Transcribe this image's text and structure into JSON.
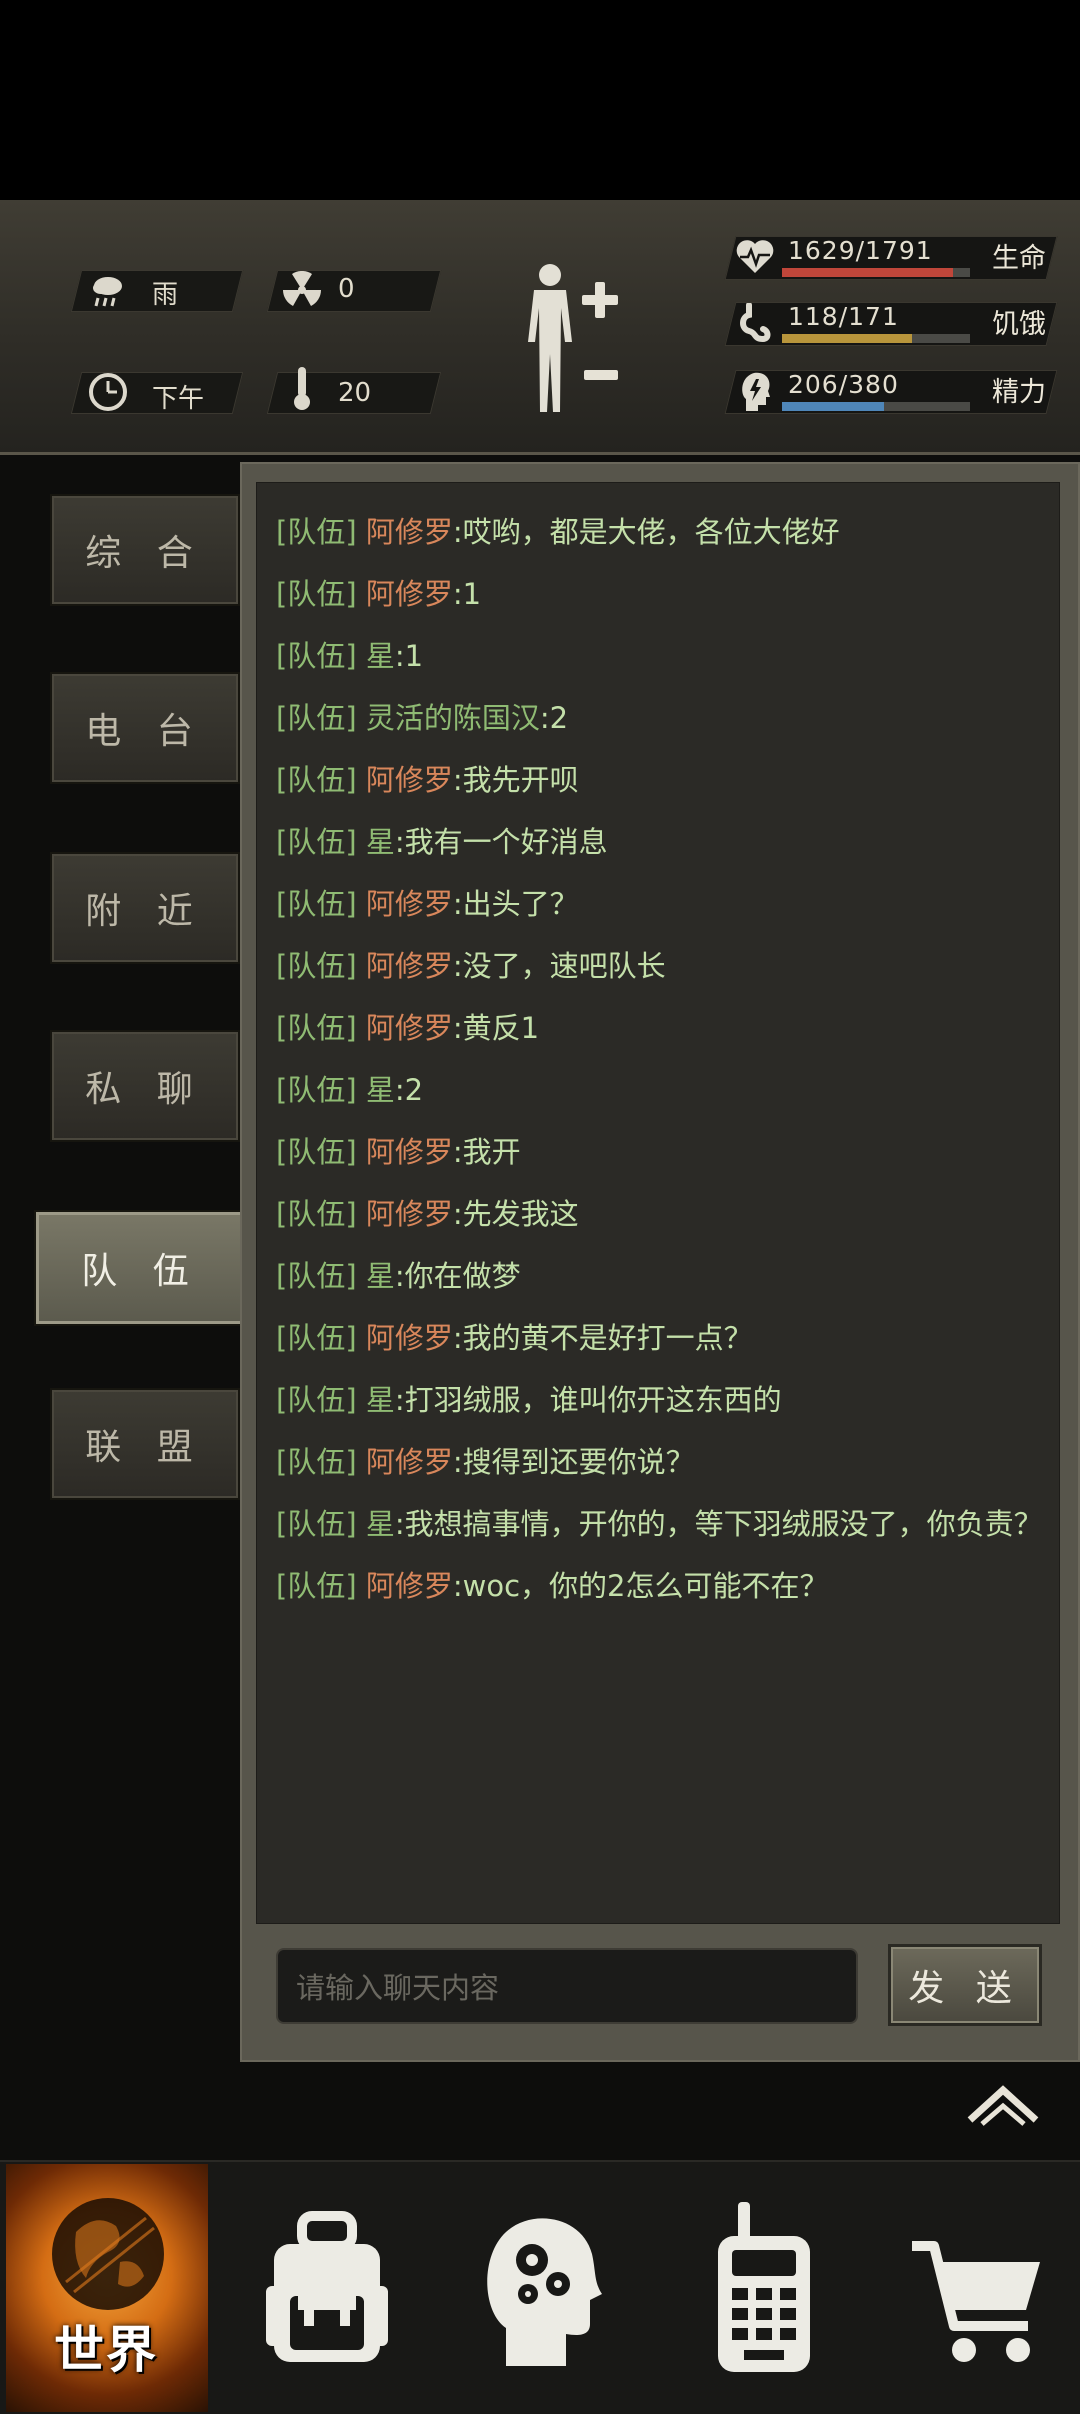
{
  "hud": {
    "weather": "雨",
    "radiation": "0",
    "time_of_day": "下午",
    "temperature": "20",
    "stats": [
      {
        "icon": "heart-pulse-icon",
        "value": "1629/1791",
        "label": "生命",
        "fill_fraction": 0.91,
        "color": "#c0463a"
      },
      {
        "icon": "stomach-icon",
        "value": "118/171",
        "label": "饥饿",
        "fill_fraction": 0.69,
        "color": "#b8953b"
      },
      {
        "icon": "energy-head-icon",
        "value": "206/380",
        "label": "精力",
        "fill_fraction": 0.54,
        "color": "#4f86b8"
      }
    ]
  },
  "tabs": [
    {
      "label": "综 合",
      "active": false
    },
    {
      "label": "电 台",
      "active": false
    },
    {
      "label": "附 近",
      "active": false
    },
    {
      "label": "私 聊",
      "active": false
    },
    {
      "label": "队 伍",
      "active": true
    },
    {
      "label": "联 盟",
      "active": false
    }
  ],
  "chat": {
    "channel": "[队伍]",
    "messages": [
      {
        "sender": "阿修罗",
        "sender_color": "orange",
        "text": ":哎哟，都是大佬，各位大佬好"
      },
      {
        "sender": "阿修罗",
        "sender_color": "orange",
        "text": ":1"
      },
      {
        "sender": "星",
        "sender_color": "green",
        "text": ":1"
      },
      {
        "sender": "灵活的陈国汉",
        "sender_color": "green",
        "text": ":2"
      },
      {
        "sender": "阿修罗",
        "sender_color": "orange",
        "text": ":我先开呗"
      },
      {
        "sender": "星",
        "sender_color": "green",
        "text": ":我有一个好消息"
      },
      {
        "sender": "阿修罗",
        "sender_color": "orange",
        "text": ":出头了？"
      },
      {
        "sender": "阿修罗",
        "sender_color": "orange",
        "text": ":没了，速吧队长"
      },
      {
        "sender": "阿修罗",
        "sender_color": "orange",
        "text": ":黄反1"
      },
      {
        "sender": "星",
        "sender_color": "green",
        "text": ":2"
      },
      {
        "sender": "阿修罗",
        "sender_color": "orange",
        "text": ":我开"
      },
      {
        "sender": "阿修罗",
        "sender_color": "orange",
        "text": ":先发我这"
      },
      {
        "sender": "星",
        "sender_color": "green",
        "text": ":你在做梦"
      },
      {
        "sender": "阿修罗",
        "sender_color": "orange",
        "text": ":我的黄不是好打一点？"
      },
      {
        "sender": "星",
        "sender_color": "green",
        "text": ":打羽绒服，谁叫你开这东西的"
      },
      {
        "sender": "阿修罗",
        "sender_color": "orange",
        "text": ":搜得到还要你说？"
      },
      {
        "sender": "星",
        "sender_color": "green",
        "text": ":我想搞事情，开你的，等下羽绒服没了，你负责？"
      },
      {
        "sender": "阿修罗",
        "sender_color": "orange",
        "text": ":woc，你的2怎么可能不在？"
      }
    ],
    "input_placeholder": "请输入聊天内容",
    "send_label": "发 送"
  },
  "bottom_nav": [
    {
      "label": "世界",
      "icon": "globe-icon",
      "active": true
    },
    {
      "label": "",
      "icon": "backpack-icon",
      "active": false
    },
    {
      "label": "",
      "icon": "head-gears-icon",
      "active": false
    },
    {
      "label": "",
      "icon": "walkie-talkie-icon",
      "active": false
    },
    {
      "label": "",
      "icon": "shopping-cart-icon",
      "active": false
    }
  ]
}
